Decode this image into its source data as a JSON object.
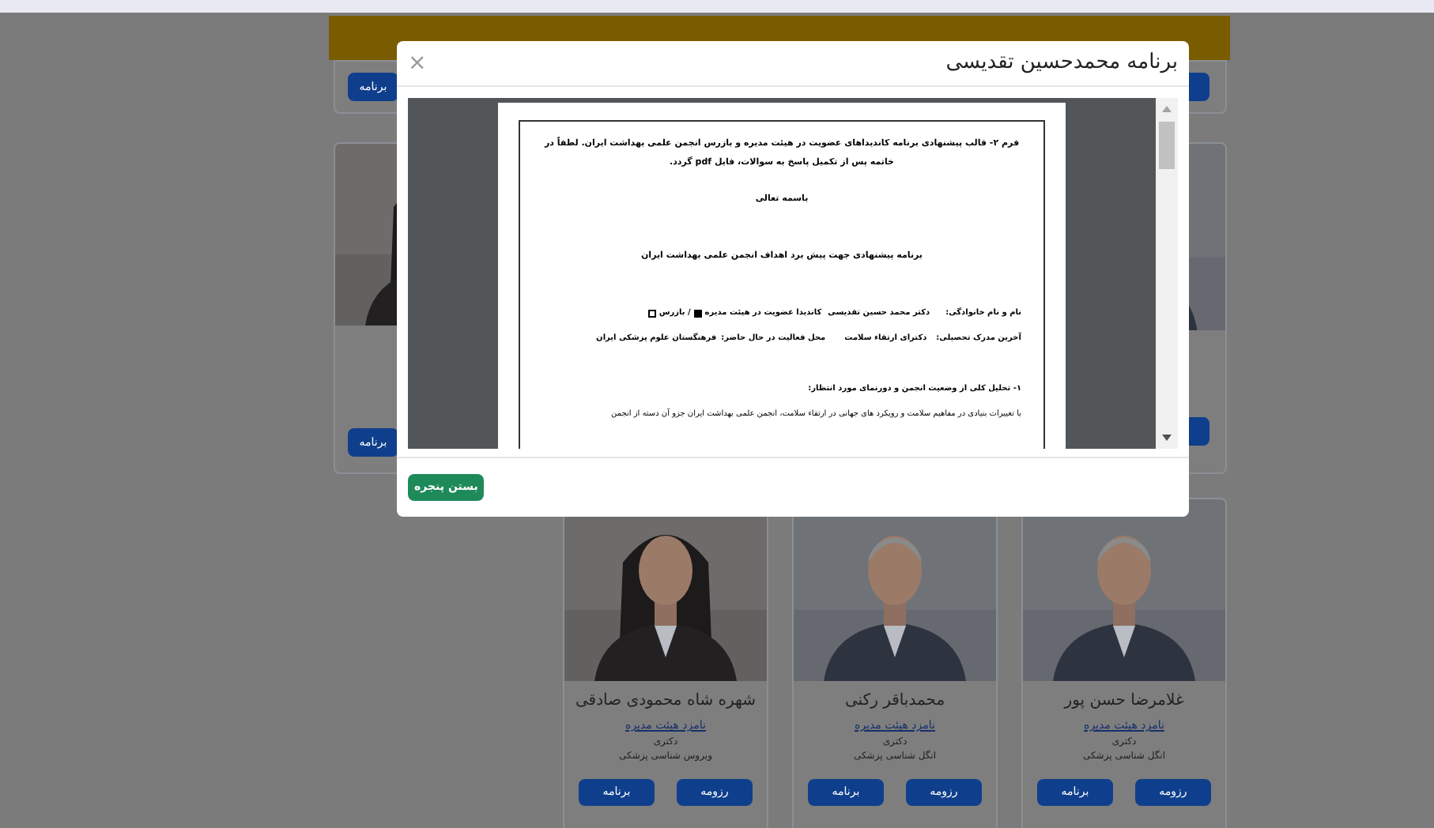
{
  "row_above": {
    "left_button": "برنامه"
  },
  "row_middle": {
    "left_button": "برنامه"
  },
  "modal": {
    "title": "برنامه محمدحسین تقدیسی",
    "close": "×",
    "close_button": "بستن پنجره",
    "document": {
      "heading": "فرم ۲- قالب پیشنهادی برنامه کاندیداهای عضویت در هیئت مدیره و بازرس انجمن علمی بهداشت ایران. لطفاً در خاتمه پس از تکمیل پاسخ به سوالات، فایل **pdf** گردد.",
      "salutation": "باسمه تعالی",
      "title": "برنامه پیشنهادی جهت پیش برد اهداف انجمن علمی بهداشت ایران",
      "name_label": "نام و نام خانوادگی:",
      "name_value": "دکتر محمد حسین تقدیسی",
      "board_label": "کاندیدا عضویت در هیئت مدیره",
      "board_checked": true,
      "inspector_label": "/ بازرس",
      "inspector_checked": false,
      "degree_label": "آخرین مدرک تحصیلی:",
      "degree_value": "دکترای ارتقاء سلامت",
      "workplace_label": "محل فعالیت در حال حاضر:",
      "workplace_value": "فرهنگستان علوم پزشکی ایران",
      "section": "۱- تحلیل کلی از وضعیت انجمن و دورنمای مورد انتظار:",
      "paragraph": "با تغییرات بنیادی در مفاهیم سلامت و رویکرد های جهانی در ارتقاء سلامت، انجمن علمی بهداشت ایران جزو آن دسته از انجمن"
    }
  },
  "cards": [
    {
      "name": "غلامرضا حسن پور",
      "role": "نامزد هیئت مدیره",
      "degree": "دکتری",
      "field": "انگل شناسی پزشکی",
      "resume": "رزومه",
      "program": "برنامه"
    },
    {
      "name": "محمدباقر رکنی",
      "role": "نامزد هیئت مدیره",
      "degree": "دکتری",
      "field": "انگل شناسی پزشکی",
      "resume": "رزومه",
      "program": "برنامه"
    },
    {
      "name": "شهره شاه محمودی صادقی",
      "role": "نامزد هیئت مدیره",
      "degree": "دکتری",
      "field": "ویروس شناسی پزشکی",
      "resume": "رزومه",
      "program": "برنامه"
    }
  ]
}
